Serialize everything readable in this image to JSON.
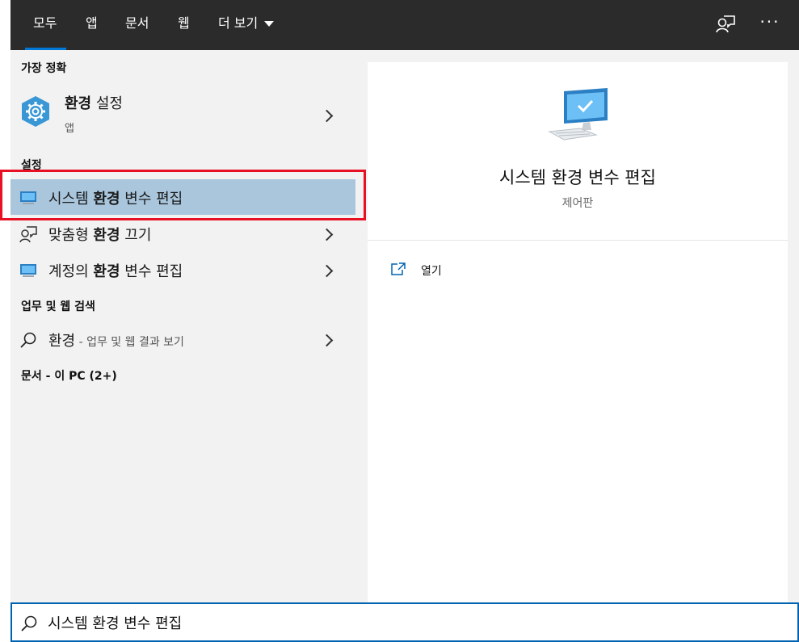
{
  "tabs": [
    {
      "label": "모두"
    },
    {
      "label": "앱"
    },
    {
      "label": "문서"
    },
    {
      "label": "웹"
    },
    {
      "label": "더 보기"
    }
  ],
  "sections": {
    "best_match": "가장 정확",
    "settings": "설정",
    "web": "업무 및 웹 검색",
    "docs": "문서 - 이 PC (2+)"
  },
  "best_match_item": {
    "bold": "환경",
    "rest": " 설정",
    "type": "앱"
  },
  "settings_items": [
    {
      "pre": "시스템 ",
      "bold": "환경",
      "post": " 변수 편집"
    },
    {
      "pre": "맞춤형 ",
      "bold": "환경",
      "post": " 끄기"
    },
    {
      "pre": "계정의 ",
      "bold": "환경",
      "post": " 변수 편집"
    }
  ],
  "web_item": {
    "term": "환경",
    "suffix": " - 업무 및 웹 결과 보기"
  },
  "preview": {
    "title": "시스템 환경 변수 편집",
    "subtitle": "제어판",
    "actions": [
      {
        "label": "열기"
      }
    ]
  },
  "search": {
    "value": "시스템 환경 변수 편집"
  },
  "colors": {
    "accent": "#0078d7",
    "selected": "#a9c6dd",
    "highlight_box": "#e81123",
    "topbar": "#2b2b2b"
  }
}
